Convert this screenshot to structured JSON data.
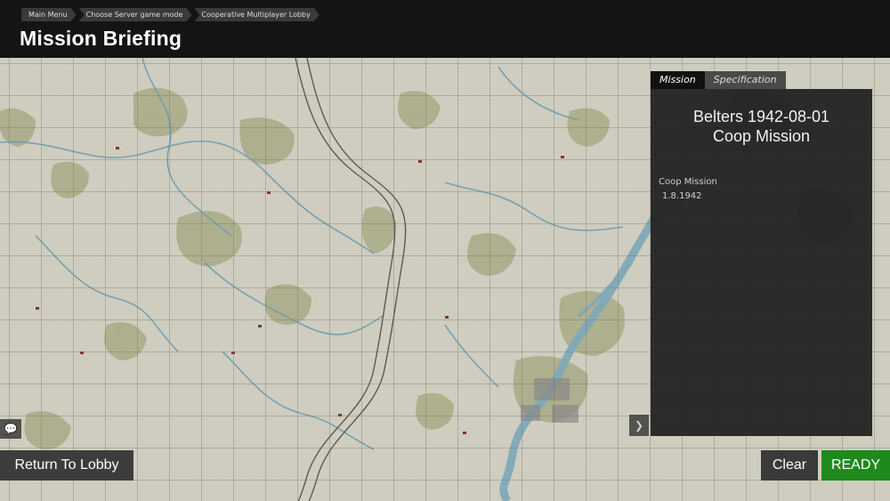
{
  "breadcrumb": [
    {
      "label": "Main Menu"
    },
    {
      "label": "Choose Server game mode"
    },
    {
      "label": "Cooperative Multiplayer Lobby"
    }
  ],
  "page_title": "Mission Briefing",
  "tabs": [
    {
      "label": "Mission",
      "active": true
    },
    {
      "label": "Specification",
      "active": false
    }
  ],
  "briefing": {
    "title": "Belters 1942-08-01",
    "subtitle": "Coop Mission",
    "description_line1": "Coop Mission",
    "description_line2": "1.8.1942"
  },
  "buttons": {
    "return_lobby": "Return To Lobby",
    "clear": "Clear",
    "ready": "READY"
  },
  "icons": {
    "chat": "chat-icon",
    "collapse": "chevron-right-icon"
  },
  "colors": {
    "ready": "#1e8a1e",
    "map_base": "#cfcdbf",
    "forest": "#9ea27a",
    "river": "#7fa9b8"
  }
}
